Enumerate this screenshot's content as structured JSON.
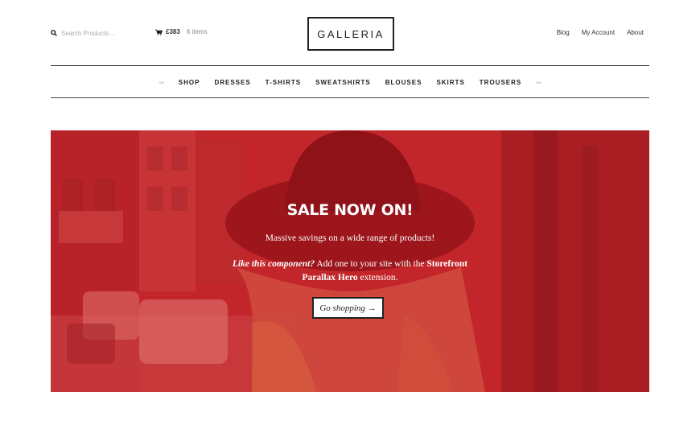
{
  "header": {
    "search": {
      "placeholder": "Search Products…",
      "icon": "search-icon"
    },
    "cart": {
      "icon": "cart-icon",
      "amount": "£383",
      "items": "6 items"
    },
    "logo": "GALLERIA",
    "links": [
      "Blog",
      "My Account",
      "About"
    ]
  },
  "nav": {
    "left_tiny": "Gift",
    "items": [
      "SHOP",
      "DRESSES",
      "T-SHIRTS",
      "SWEATSHIRTS",
      "BLOUSES",
      "SKIRTS",
      "TROUSERS"
    ],
    "right_tiny": "Gift"
  },
  "hero": {
    "title": "SALE NOW ON!",
    "subtitle": "Massive savings on a wide range of products!",
    "promo_italic": "Like this component?",
    "promo_mid": " Add one to your site with the ",
    "promo_bold": "Storefront Parallax Hero",
    "promo_end": " extension.",
    "button": "Go shopping →",
    "overlay_color": "#c2262a"
  }
}
